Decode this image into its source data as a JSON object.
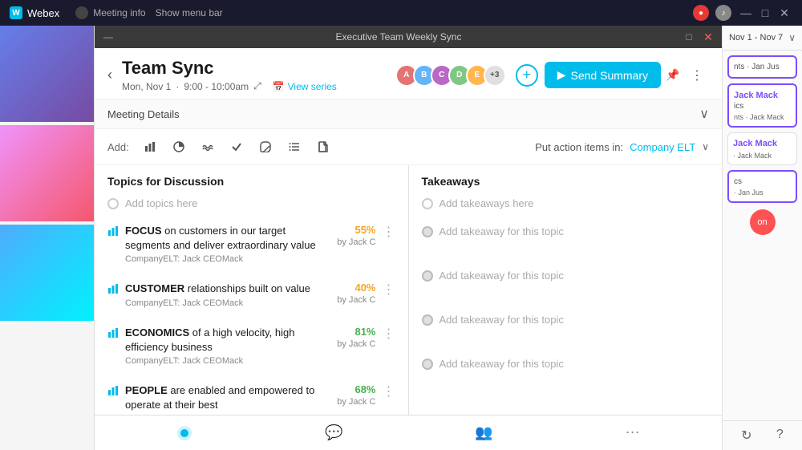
{
  "app": {
    "name": "Webex",
    "taskbar_title": "Webex",
    "meeting_info": "Meeting info",
    "show_menu": "Show menu bar"
  },
  "window": {
    "title": "Executive Team Weekly Sync",
    "controls": [
      "—",
      "□",
      "✕"
    ]
  },
  "meeting": {
    "title": "Team Sync",
    "date": "Mon, Nov 1",
    "time": "9:00 - 10:00am",
    "external_link": "⤢",
    "view_series": "View series",
    "avatar_count": "+3",
    "send_summary": "Send Summary",
    "put_action_items": "Put action items in:",
    "company_elt": "Company ELT"
  },
  "details_bar": {
    "label": "Meeting Details",
    "collapse": "∨"
  },
  "toolbar": {
    "add_label": "Add:",
    "icons": [
      "bar-chart",
      "pie-chart",
      "waves",
      "checkmark",
      "paperclip",
      "list",
      "file"
    ]
  },
  "topics": {
    "panel_title": "Topics for Discussion",
    "add_placeholder": "Add topics here",
    "items": [
      {
        "text_strong": "FOCUS",
        "text_rest": " on customers in our target segments and deliver extraordinary value",
        "meta": "CompanyELT: Jack CEOMack",
        "percent": "55%",
        "percent_color": "#f5a623",
        "by": "by Jack C"
      },
      {
        "text_strong": "CUSTOMER",
        "text_rest": " relationships built on value",
        "meta": "CompanyELT: Jack CEOMack",
        "percent": "40%",
        "percent_color": "#f5a623",
        "by": "by Jack C"
      },
      {
        "text_strong": "ECONOMICS",
        "text_rest": " of a high velocity, high efficiency business",
        "meta": "CompanyELT: Jack CEOMack",
        "percent": "81%",
        "percent_color": "#4caf50",
        "by": "by Jack C"
      },
      {
        "text_strong": "PEOPLE",
        "text_rest": " are enabled and empowered to operate at their best",
        "meta": "",
        "percent": "68%",
        "percent_color": "#4caf50",
        "by": "by Jack C"
      }
    ]
  },
  "takeaways": {
    "panel_title": "Takeaways",
    "add_placeholder": "Add takeaways here",
    "items": [
      "Add takeaway for this topic",
      "Add takeaway for this topic",
      "Add takeaway for this topic",
      "Add takeaway for this topic"
    ]
  },
  "right_sidebar": {
    "date_range": "Nov 1 - Nov 7",
    "cards": [
      {
        "text": "nts · Jan Jus",
        "author": "",
        "bordered": true
      },
      {
        "text": "ics\nnts · Jack Mack",
        "label": "Jack Mack (heading)",
        "bordered": true
      },
      {
        "text": "· Jack Mack",
        "label": "Jack Mack",
        "bordered": false
      },
      {
        "text": "cs\n· Jan Jus",
        "label": "",
        "bordered": true
      }
    ],
    "badge_label": "on"
  },
  "avatars": [
    {
      "color": "#e57373",
      "initial": "A"
    },
    {
      "color": "#64b5f6",
      "initial": "B"
    },
    {
      "color": "#ba68c8",
      "initial": "C"
    },
    {
      "color": "#81c784",
      "initial": "D"
    },
    {
      "color": "#ffb74d",
      "initial": "E"
    }
  ]
}
